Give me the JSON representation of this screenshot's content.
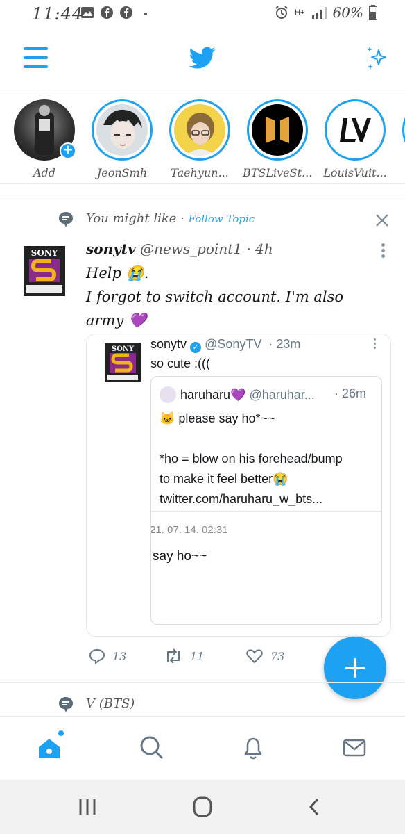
{
  "status_bar": {
    "time": "11:44",
    "signal_label": "H+",
    "battery": "60%"
  },
  "header": {
    "menu_icon": "hamburger-menu-icon",
    "logo": "twitter-bird-icon",
    "sparkle_icon": "sparkle-icon"
  },
  "fleets": [
    {
      "label": "Add"
    },
    {
      "label": "JeonSmh"
    },
    {
      "label": "Taehyun..."
    },
    {
      "label": "BTSLiveSt..."
    },
    {
      "label": "LouisVuit..."
    }
  ],
  "topic_banner": {
    "text": "You might like",
    "separator": " · ",
    "follow": "Follow Topic"
  },
  "tweet": {
    "display_name": "sonytv",
    "handle": "@news_point1",
    "time": " · 4h",
    "avatar_text": "SONY",
    "body_line1": "Help 😭.",
    "body_line2": "I forgot to switch account. I'm also",
    "body_line3": "army 💜",
    "quote": {
      "name": "sonytv",
      "handle": "@SonyTV",
      "time": "·  23m",
      "avatar_text": "SONY",
      "text": "so cute :(((",
      "inner": {
        "name": "haruharu💜",
        "handle": "@haruhar...",
        "time": "·  26m",
        "line1": "🐱 please say ho*~~",
        "line2": "*ho = blow on his forehead/bump",
        "line3": "to make it feel better😭",
        "line4": "twitter.com/haruharu_w_bts...",
        "date": "21. 07. 14. 02:31",
        "reply": "say ho~~"
      }
    },
    "actions": {
      "replies": "13",
      "retweets": "11",
      "likes": "73"
    }
  },
  "topic_banner_2": {
    "text": "V (BTS)"
  },
  "colors": {
    "accent": "#1da1f2",
    "text": "#14171a",
    "muted": "#657786"
  }
}
